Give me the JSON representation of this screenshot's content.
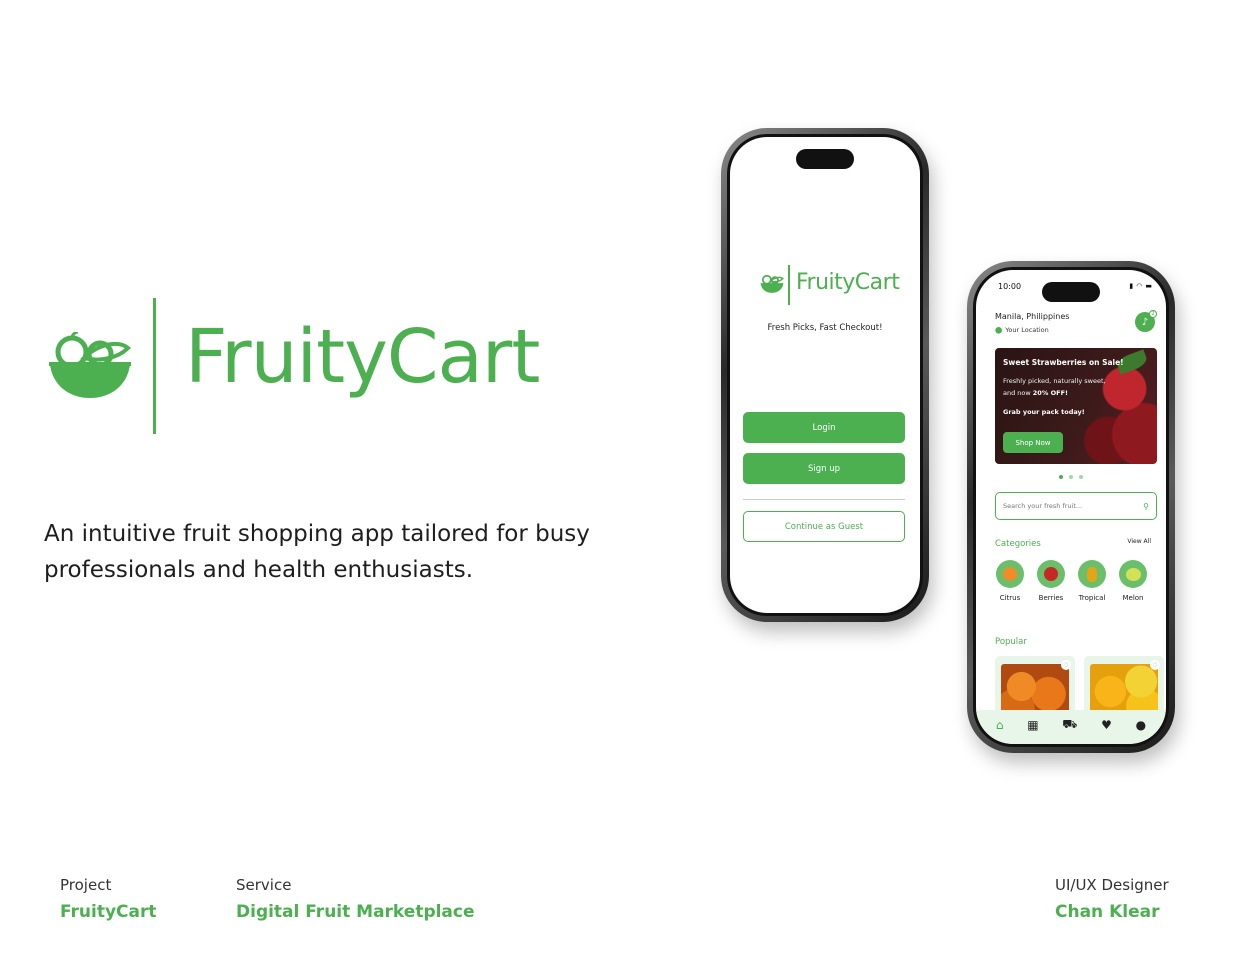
{
  "brand": {
    "name": "FruityCart",
    "accent_color": "#4caf50",
    "logo_icon": "fruit-bowl-icon"
  },
  "tagline": {
    "line1": "An intuitive fruit shopping app tailored for busy",
    "line2": "professionals and health enthusiasts."
  },
  "footer": {
    "project_label": "Project",
    "project_value": "FruityCart",
    "service_label": "Service",
    "service_value": "Digital Fruit Marketplace",
    "designer_label": "UI/UX Designer",
    "designer_value": "Chan Klear"
  },
  "welcome_screen": {
    "app_name": "FruityCart",
    "tagline": "Fresh Picks, Fast Checkout!",
    "login_label": "Login",
    "signup_label": "Sign up",
    "guest_label": "Continue as Guest"
  },
  "home_screen": {
    "status_time": "10:00",
    "city": "Manila, Philippines",
    "location_label": "Your Location",
    "notification_count": "2",
    "banner": {
      "title": "Sweet Strawberries on Sale!",
      "desc_line1": "Freshly picked, naturally sweet,",
      "desc_line2_prefix": "and now ",
      "desc_line2_bold": "20% OFF!",
      "cta_text": "Grab your pack today!",
      "button_label": "Shop Now"
    },
    "carousel_active_index": 0,
    "search_placeholder": "Search your fresh fruit...",
    "categories_title": "Categories",
    "view_all_label": "View All",
    "categories": [
      {
        "label": "Citrus",
        "icon": "orange-icon"
      },
      {
        "label": "Berries",
        "icon": "cherries-icon"
      },
      {
        "label": "Tropical",
        "icon": "pineapple-icon"
      },
      {
        "label": "Melon",
        "icon": "melon-icon"
      }
    ],
    "popular_title": "Popular",
    "nav_items": [
      "home-icon",
      "grid-icon",
      "cart-icon",
      "heart-icon",
      "profile-icon"
    ]
  }
}
